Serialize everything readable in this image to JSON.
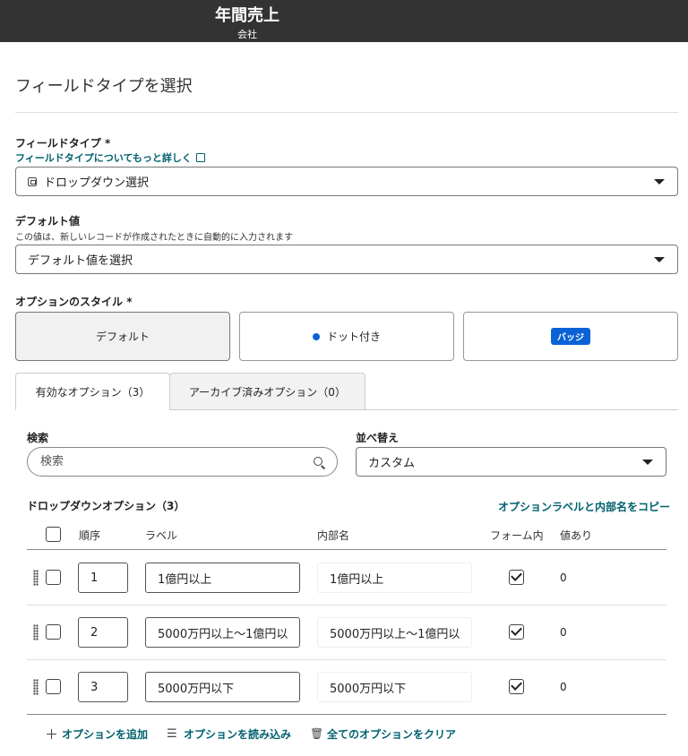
{
  "header": {
    "title": "年間売上",
    "subtitle": "会社"
  },
  "page": {
    "title": "フィールドタイプを選択"
  },
  "field_type": {
    "label": "フィールドタイプ",
    "required_mark": "*",
    "help_link": "フィールドタイプについてもっと詳しく",
    "value": "ドロップダウン選択"
  },
  "default_value": {
    "label": "デフォルト値",
    "hint": "この値は、新しいレコードが作成されたときに自動的に入力されます",
    "placeholder": "デフォルト値を選択"
  },
  "option_style": {
    "label": "オプションのスタイル",
    "required_mark": "*",
    "cards": [
      {
        "label": "デフォルト",
        "selected": true
      },
      {
        "label": "ドット付き",
        "selected": false,
        "dot_color": "#0a62d6"
      },
      {
        "label": "バッジ",
        "selected": false,
        "badge_color": "#0a62d6"
      }
    ]
  },
  "tabs": [
    {
      "label": "有効なオプション（3）",
      "active": true
    },
    {
      "label": "アーカイブ済みオプション（0）",
      "active": false
    }
  ],
  "search": {
    "label": "検索",
    "placeholder": "検索"
  },
  "sort": {
    "label": "並べ替え",
    "value": "カスタム"
  },
  "options_table": {
    "title": "ドロップダウンオプション（3）",
    "copy_link": "オプションラベルと内部名をコピー",
    "headers": {
      "order": "順序",
      "label": "ラベル",
      "internal": "内部名",
      "in_form": "フォーム内",
      "has_value": "値あり"
    },
    "rows": [
      {
        "order": "1",
        "label": "1億円以上",
        "internal": "1億円以上",
        "in_form": true,
        "count": "0"
      },
      {
        "order": "2",
        "label": "5000万円以上〜1億円以",
        "internal": "5000万円以上〜1億円以",
        "in_form": true,
        "count": "0"
      },
      {
        "order": "3",
        "label": "5000万円以下",
        "internal": "5000万円以下",
        "in_form": true,
        "count": "0"
      }
    ]
  },
  "actions": {
    "add": "オプションを追加",
    "import": "オプションを読み込み",
    "clear": "全てのオプションをクリア"
  },
  "colors": {
    "header_bg": "#333333",
    "link": "#00616e",
    "accent": "#0a62d6"
  }
}
